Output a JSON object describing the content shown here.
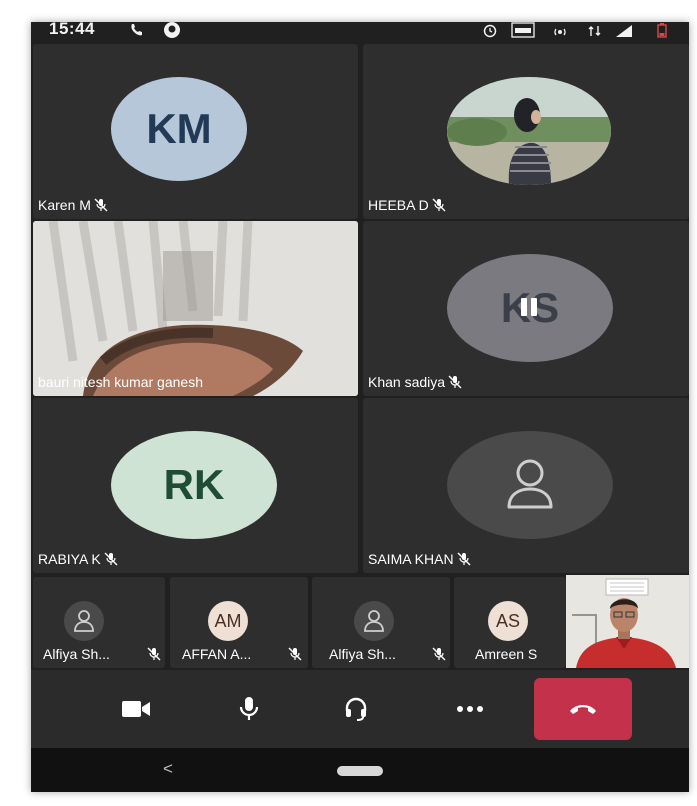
{
  "status_bar": {
    "time": "15:44",
    "left_icons": [
      "phone-call-icon",
      "teams-notification-icon"
    ],
    "right_icons": [
      "alarm-icon",
      "lte-icon",
      "hotspot-icon",
      "data-arrows-icon",
      "signal-icon",
      "battery-icon"
    ]
  },
  "participants": [
    {
      "name": "Karen M",
      "initials": "KM",
      "avatar_bg": "#b5c7d8",
      "initials_color": "#233a57",
      "muted": true,
      "video": false
    },
    {
      "name": "HEEBA D",
      "initials": "",
      "avatar_bg": "#8fa58a",
      "muted": true,
      "video": false,
      "photo": true
    },
    {
      "name": "bauri nitesh kumar ganesh",
      "initials": "",
      "muted": false,
      "video": true
    },
    {
      "name": "Khan sadiya",
      "initials": "KS",
      "avatar_bg": "#7a7a80",
      "initials_color": "#3b3f4a",
      "muted": true,
      "video": false,
      "pause_overlay": true
    },
    {
      "name": "RABIYA K",
      "initials": "RK",
      "avatar_bg": "#cfe3d4",
      "initials_color": "#1e4d33",
      "muted": true,
      "video": false
    },
    {
      "name": "SAIMA KHAN",
      "initials": "",
      "avatar_bg": "#4a4a4a",
      "muted": true,
      "video": false,
      "generic_avatar": true
    }
  ],
  "overflow_participants": [
    {
      "name": "Alfiya Sh...",
      "initials": "",
      "avatar_bg": "#4a4a4a",
      "muted": true,
      "generic_avatar": true
    },
    {
      "name": "AFFAN A...",
      "initials": "AM",
      "avatar_bg": "#efe0d6",
      "initials_color": "#4a2f25",
      "muted": true
    },
    {
      "name": "Alfiya Sh...",
      "initials": "",
      "avatar_bg": "#4a4a4a",
      "muted": true,
      "generic_avatar": true
    },
    {
      "name": "Amreen S",
      "initials": "AS",
      "avatar_bg": "#efe0d6",
      "initials_color": "#4a2f25",
      "muted": false
    }
  ],
  "self_view": {
    "icon": "self-video-thumbnail"
  },
  "controls": [
    {
      "name": "video-camera-button",
      "icon": "video-camera-icon"
    },
    {
      "name": "microphone-button",
      "icon": "microphone-icon"
    },
    {
      "name": "audio-device-button",
      "icon": "headset-icon"
    },
    {
      "name": "more-options-button",
      "icon": "more-dots-icon"
    },
    {
      "name": "hang-up-button",
      "icon": "phone-hangup-icon",
      "color": "#c4314b"
    }
  ],
  "nav_bar": {
    "back": "<",
    "home_icon": "home-pill-icon"
  }
}
